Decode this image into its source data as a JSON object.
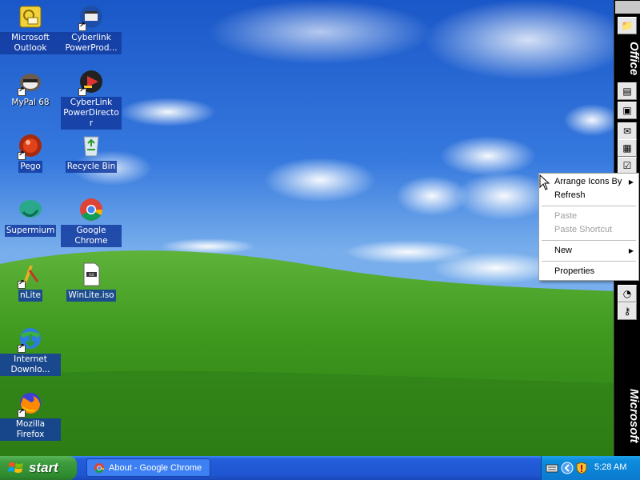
{
  "desktop": {
    "icons": [
      {
        "label": "Microsoft Outlook",
        "icon": "outlook-icon"
      },
      {
        "label": "Cyberlink PowerProd...",
        "icon": "cyberlink-producer-icon"
      },
      {
        "label": "MyPal 68",
        "icon": "mypal-icon"
      },
      {
        "label": "CyberLink PowerDirector",
        "icon": "powerdirector-icon"
      },
      {
        "label": "Pego",
        "icon": "pego-icon"
      },
      {
        "label": "Recycle Bin",
        "icon": "recycle-bin-icon"
      },
      {
        "label": "Supermium",
        "icon": "supermium-icon"
      },
      {
        "label": "Google Chrome",
        "icon": "chrome-icon"
      },
      {
        "label": "nLite",
        "icon": "nlite-icon"
      },
      {
        "label": "WinLite.iso",
        "icon": "iso-file-icon"
      },
      {
        "label": "Internet Downlo...",
        "icon": "internet-download-manager-icon"
      },
      {
        "label": "Mozilla Firefox",
        "icon": "firefox-icon"
      }
    ]
  },
  "officebar": {
    "title": "Office",
    "brand": "Microsoft"
  },
  "context_menu": {
    "items": [
      {
        "label": "Arrange Icons By",
        "submenu": true,
        "enabled": true
      },
      {
        "label": "Refresh",
        "submenu": false,
        "enabled": true
      },
      {
        "label": "Paste",
        "submenu": false,
        "enabled": false
      },
      {
        "label": "Paste Shortcut",
        "submenu": false,
        "enabled": false
      },
      {
        "label": "New",
        "submenu": true,
        "enabled": true
      },
      {
        "label": "Properties",
        "submenu": false,
        "enabled": true
      }
    ]
  },
  "taskbar": {
    "start_label": "start",
    "tasks": [
      {
        "label": "About - Google Chrome",
        "icon": "chrome-icon"
      }
    ],
    "tray": {
      "clock": "5:28 AM",
      "icons": [
        "keyboard-icon",
        "expand-tray-icon",
        "security-shield-icon"
      ]
    }
  },
  "colors": {
    "taskbar": "#245edb",
    "start_button": "#3f9d3f",
    "selection": "#316ac5",
    "tray": "#0b7bcf"
  }
}
